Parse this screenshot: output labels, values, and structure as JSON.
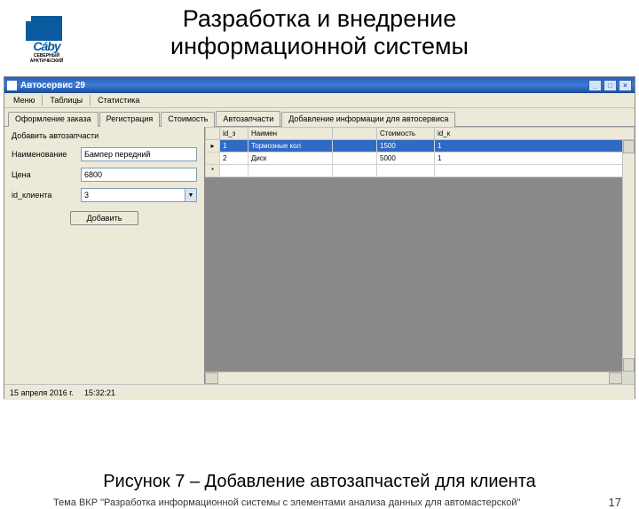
{
  "slide": {
    "title_line1": "Разработка и внедрение",
    "title_line2": "информационной системы",
    "logo_main": "Cáby",
    "logo_sub": "СЕВЕРНЫЙ АРКТИЧЕСКИЙ",
    "caption": "Рисунок 7 – Добавление автозапчастей для клиента",
    "footer": "Тема ВКР \"Разработка информационной системы с элементами анализа данных для автомастерской\"",
    "page": "17"
  },
  "app": {
    "title": "Автосервис 29",
    "menu": {
      "m1": "Меню",
      "m2": "Таблицы",
      "m3": "Статистика"
    },
    "tabs": {
      "t1": "Оформление заказа",
      "t2": "Регистрация",
      "t3": "Стоимость",
      "t4": "Автозапчасти",
      "t5": "Добавление информации для автосервиса"
    },
    "form": {
      "title": "Добавить автозапчасти",
      "l_name": "Наименование",
      "l_price": "Цена",
      "l_client": "id_клиента",
      "v_name": "Бампер передний",
      "v_price": "6800",
      "v_client": "3",
      "btn": "Добавить"
    },
    "grid": {
      "h_row": "",
      "h1": "id_з",
      "h2": "Наимен",
      "h3": "",
      "h4": "Стоимость",
      "h5": "id_к",
      "rows": [
        {
          "id": "1",
          "name": "Тормозные кол",
          "p": "",
          "cost": "1500",
          "cl": "1"
        },
        {
          "id": "2",
          "name": "Диск",
          "p": "",
          "cost": "5000",
          "cl": "1"
        }
      ],
      "star": "*"
    },
    "status": {
      "date": "15 апреля 2016 г.",
      "time": "15:32:21"
    }
  }
}
